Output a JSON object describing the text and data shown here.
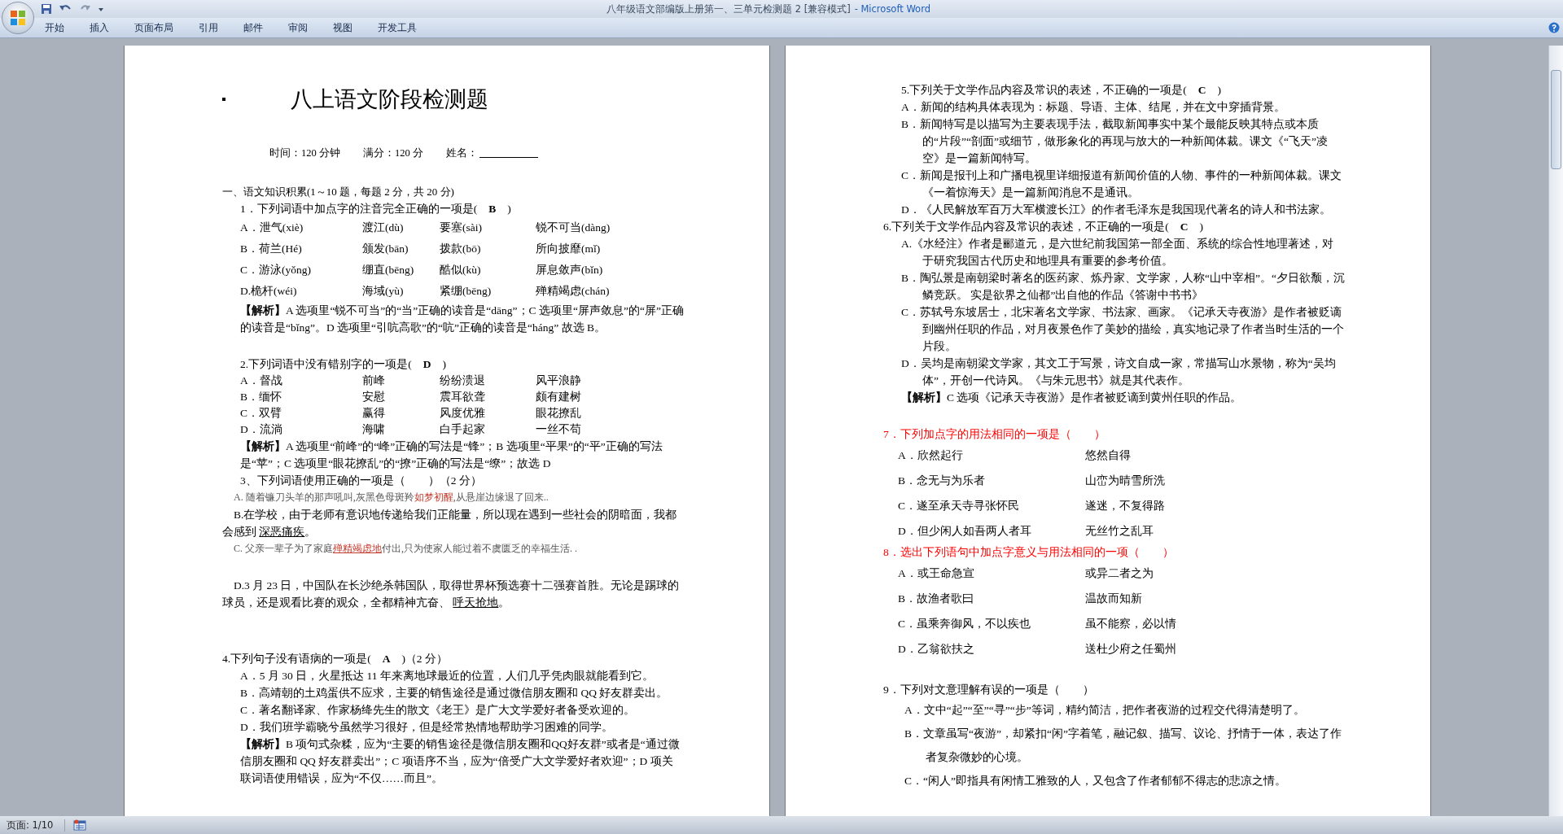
{
  "window": {
    "title": "八年级语文部编版上册第一、三单元检测题 2 [兼容模式]",
    "app": "- Microsoft Word"
  },
  "ribbon_tabs": [
    {
      "label": "开始"
    },
    {
      "label": "插入"
    },
    {
      "label": "页面布局"
    },
    {
      "label": "引用"
    },
    {
      "label": "邮件"
    },
    {
      "label": "审阅"
    },
    {
      "label": "视图"
    },
    {
      "label": "开发工具"
    }
  ],
  "pages": [
    {
      "blocks": [
        {
          "kind": "title",
          "text": "八上语文阶段检测题"
        },
        {
          "kind": "info",
          "items": [
            "时间：120 分钟",
            "满分：120 分",
            "姓名："
          ]
        },
        {
          "kind": "blank"
        },
        {
          "kind": "heading",
          "text": "一、语文知识积累(1～10 题，每题 2 分，共 20 分)"
        },
        {
          "kind": "question",
          "color": "#000000",
          "text": "1．下列词语中加点字的注音完全正确的一项是(　**B**　)"
        },
        {
          "kind": "grid",
          "cells": [
            "A．泄气(xiè)",
            "渡江(dù)",
            "要塞(sài)",
            "锐不可当(dàng)"
          ]
        },
        {
          "kind": "grid",
          "cells": [
            "B．荷兰(Hé)",
            "颁发(bān)",
            "拨款(bō)",
            "所向披靡(mǐ)"
          ]
        },
        {
          "kind": "grid",
          "cells": [
            "C．游泳(yǒng)",
            "绷直(bēng)",
            "酷似(kù)",
            "屏息敛声(bǐn)"
          ]
        },
        {
          "kind": "grid",
          "cells": [
            "D.桅杆(wéi)",
            "海域(yù)",
            "紧绷(bēng)",
            "殚精竭虑(chán)"
          ]
        },
        {
          "kind": "analysis",
          "text": "**【解析】**A 选项里“锐不可当”的“当”正确的读音是“dāng”；C 选项里“屏声敛息”的“屏”正确的读音是“bǐng”。D 选项里“引吭高歌”的“吭”正确的读音是“háng” 故选 B。"
        },
        {
          "kind": "blank"
        },
        {
          "kind": "question",
          "color": "#000000",
          "text": "2.下列词语中没有错别字的一项是(　**D**　)"
        },
        {
          "kind": "grid-compact",
          "cells": [
            "A．督战",
            "前峰",
            "纷纷溃退",
            "风平浪静"
          ]
        },
        {
          "kind": "grid-compact",
          "cells": [
            "B．缅怀",
            "安慰",
            "震耳欲聋",
            "颇有建树"
          ]
        },
        {
          "kind": "grid-compact",
          "cells": [
            "C．双臂",
            "赢得",
            "风度优雅",
            "眼花撩乱"
          ]
        },
        {
          "kind": "grid-compact",
          "cells": [
            "D．流淌",
            "海啸",
            "白手起家",
            "一丝不苟"
          ]
        },
        {
          "kind": "analysis",
          "text": "**【解析】**A 选项里“前峰”的“峰”正确的写法是“锋”；B 选项里“平果”的“平”正确的写法是“苹”；C 选项里“眼花撩乱”的“撩”正确的写法是“缭”；故选 D"
        },
        {
          "kind": "question",
          "color": "#000000",
          "text": "3、下列词语使用正确的一项是（　　）（2 分）"
        },
        {
          "kind": "small",
          "segments": [
            {
              "text": "A. 随着镰刀头羊的那声吼叫,灰黑色母斑羚"
            },
            {
              "text": "如梦初醒",
              "color": "#c0392b"
            },
            {
              "text": ",从悬崖边缘退了回来.."
            }
          ]
        },
        {
          "kind": "para",
          "segments": [
            {
              "text": "B.在学校，由于老师有意识地传递给我们正能量，所以现在遇到一些社会的阴暗面，我都会感到 "
            },
            {
              "text": "深恶痛疾",
              "underline": true
            },
            {
              "text": "。"
            }
          ]
        },
        {
          "kind": "small",
          "segments": [
            {
              "text": "C. 父亲一辈子为了家庭"
            },
            {
              "text": "殚精竭虑地",
              "color": "#c0392b",
              "underline": true
            },
            {
              "text": "付出,只为使家人能过着不虞匮乏的幸福生活. ."
            }
          ]
        },
        {
          "kind": "blank"
        },
        {
          "kind": "para",
          "segments": [
            {
              "text": "D.3 月 23 日，中国队在长沙绝杀韩国队，取得世界杯预选赛十二强赛首胜。无论是踢球的球员，还是观看比赛的观众，全都精神亢奋、 "
            },
            {
              "text": "呼天抢地",
              "underline": true
            },
            {
              "text": "。"
            }
          ]
        },
        {
          "kind": "blank"
        },
        {
          "kind": "blank"
        },
        {
          "kind": "question-flush",
          "color": "#000000",
          "text": "4.下列句子没有语病的一项是(　**A**　)（2 分）"
        },
        {
          "kind": "option",
          "text": "A．5 月 30 日，火星抵达 11 年来离地球最近的位置，人们几乎凭肉眼就能看到它。"
        },
        {
          "kind": "option",
          "text": "B．高靖朝的土鸡蛋供不应求，主要的销售途径是通过微信朋友圈和 QQ 好友群卖出。"
        },
        {
          "kind": "option",
          "text": "C．著名翻译家、作家杨绛先生的散文《老王》是广大文学爱好者备受欢迎的。"
        },
        {
          "kind": "option",
          "text": "D．我们班学霸晓兮虽然学习很好，但是经常热情地帮助学习困难的同学。"
        },
        {
          "kind": "analysis",
          "text": "**【解析】**B 项句式杂糅，应为“主要的销售途径是微信朋友圈和QQ好友群”或者是“通过微信朋友圈和 QQ 好友群卖出”；C 项语序不当，应为“倍受广大文学爱好者欢迎”；D 项关联词语使用错误，应为“不仅……而且”。"
        }
      ]
    },
    {
      "blocks": [
        {
          "kind": "blank"
        },
        {
          "kind": "question",
          "color": "#000000",
          "text": "5.下列关于文学作品内容及常识的表述，不正确的一项是(　**C**　)"
        },
        {
          "kind": "option",
          "text": "A．新闻的结构具体表现为：标题、导语、主体、结尾，并在文中穿插背景。"
        },
        {
          "kind": "option",
          "text": "B．新闻特写是以描写为主要表现手法，截取新闻事实中某个最能反映其特点或本质的“片段”“剖面”或细节，做形象化的再现与放大的一种新闻体裁。课文《“飞天”凌空》是一篇新闻特写。"
        },
        {
          "kind": "option",
          "text": "C．新闻是报刊上和广播电视里详细报道有新闻价值的人物、事件的一种新闻体裁。课文《一着惊海天》是一篇新闻消息不是通讯。"
        },
        {
          "kind": "option",
          "text": "D．《人民解放军百万大军横渡长江》的作者毛泽东是我国现代著名的诗人和书法家。"
        },
        {
          "kind": "question-flush",
          "color": "#000000",
          "text": "6.下列关于文学作品内容及常识的表述，不正确的一项是(　**C**　)"
        },
        {
          "kind": "option",
          "text": "A.《水经注》作者是郦道元，是六世纪前我国第一部全面、系统的综合性地理著述，对于研究我国古代历史和地理具有重要的参考价值。"
        },
        {
          "kind": "option",
          "text": "B．陶弘景是南朝梁时著名的医药家、炼丹家、文学家，人称“山中宰相”。“夕日欲颓，沉鳞竞跃。 实是欲界之仙都”出自他的作品《答谢中书书》"
        },
        {
          "kind": "option",
          "text": "C．苏轼号东坡居士，北宋著名文学家、书法家、画家。《记承天寺夜游》是作者被贬谪到幽州任职的作品，对月夜景色作了美妙的描绘，真实地记录了作者当时生活的一个片段。"
        },
        {
          "kind": "option",
          "text": "D．吴均是南朝梁文学家，其文工于写景，诗文自成一家，常描写山水景物，称为“吴均体”，开创一代诗风。《与朱元思书》就是其代表作。"
        },
        {
          "kind": "analysis",
          "text": "**【解析】**C 选项《记承天寺夜游》是作者被贬谪到黄州任职的作品。"
        },
        {
          "kind": "blank"
        },
        {
          "kind": "question-flush",
          "color": "#ff0000",
          "text": "7．下列加点字的用法相同的一项是（　　）"
        },
        {
          "kind": "pair",
          "cells": [
            "A．欣然起行",
            "悠然自得"
          ]
        },
        {
          "kind": "pair",
          "cells": [
            "B．念无与为乐者",
            "山峦为晴雪所洗"
          ]
        },
        {
          "kind": "pair",
          "cells": [
            "C．遂至承天寺寻张怀民",
            "遂迷，不复得路"
          ]
        },
        {
          "kind": "pair",
          "cells": [
            "D．但少闲人如吾两人者耳",
            "无丝竹之乱耳"
          ]
        },
        {
          "kind": "question-flush",
          "color": "#ff0000",
          "text": "8．选出下列语句中加点字意义与用法相同的一项（　　）"
        },
        {
          "kind": "pair",
          "cells": [
            "A．或王命急宣",
            "或异二者之为"
          ]
        },
        {
          "kind": "pair",
          "cells": [
            "B．故渔者歌曰",
            "温故而知新"
          ]
        },
        {
          "kind": "pair",
          "cells": [
            "C．虽乘奔御风，不以疾也",
            "虽不能察，必以情"
          ]
        },
        {
          "kind": "pair",
          "cells": [
            "D．乙翁欲扶之",
            "送杜少府之任蜀州"
          ]
        },
        {
          "kind": "blank"
        },
        {
          "kind": "question-flush",
          "color": "#000000",
          "text": "9．下列对文意理解有误的一项是（　　）"
        },
        {
          "kind": "option-loose",
          "text": "A．文中“起”“至”“寻”“步”等词，精约简洁，把作者夜游的过程交代得清楚明了。"
        },
        {
          "kind": "option-loose",
          "text": "B．文章虽写“夜游”，却紧扣“闲”字着笔，融记叙、描写、议论、抒情于一体，表达了作者复杂微妙的心境。"
        },
        {
          "kind": "option-loose",
          "text": "C．“闲人”即指具有闲情工雅致的人，又包含了作者郁郁不得志的悲凉之情。"
        }
      ]
    }
  ],
  "status_bar": {
    "page": "页面: 1/10"
  }
}
